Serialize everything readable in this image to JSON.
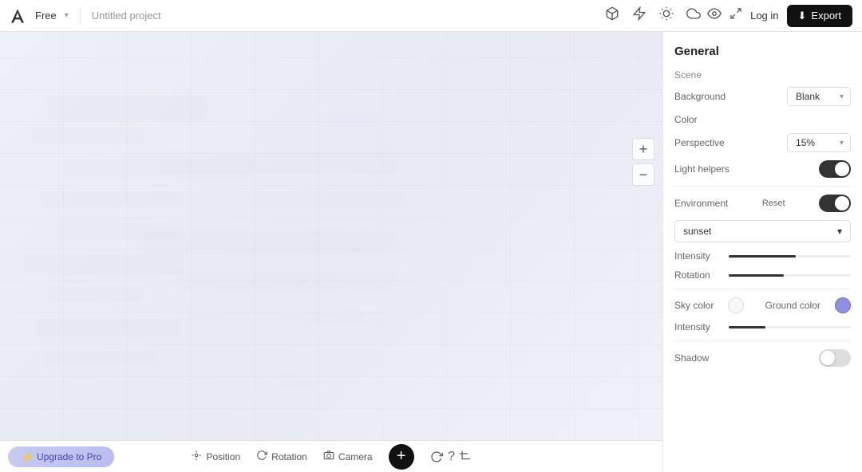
{
  "topbar": {
    "logo_alt": "Adobe logo",
    "plan_label": "Free",
    "plan_arrow": "▾",
    "project_name": "Untitled project",
    "icons": [
      {
        "name": "cube-icon",
        "symbol": "⬡"
      },
      {
        "name": "lightning-icon",
        "symbol": "⚡"
      },
      {
        "name": "sun-icon",
        "symbol": "☀"
      },
      {
        "name": "cloud-icon",
        "symbol": "☁"
      }
    ],
    "eye_icon": "👁",
    "expand_icon": "⤢",
    "login_label": "Log in",
    "export_icon": "⬇",
    "export_label": "Export"
  },
  "canvas": {
    "plus_label": "+",
    "minus_label": "−"
  },
  "bottom_toolbar": {
    "position_label": "Position",
    "rotation_label": "Rotation",
    "camera_label": "Camera",
    "add_icon": "+",
    "refresh_icon": "↻",
    "crop_icon": "⊡",
    "help_icon": "?"
  },
  "upgrade": {
    "icon": "⚡",
    "label": "Upgrade to Pro"
  },
  "panel": {
    "title": "General",
    "scene_label": "Scene",
    "background_label": "Background",
    "background_value": "Blank",
    "color_label": "Color",
    "perspective_label": "Perspective",
    "perspective_value": "15%",
    "light_helpers_label": "Light helpers",
    "environment_label": "Environment",
    "environment_reset": "Reset",
    "environment_dropdown": "sunset",
    "intensity_label": "Intensity",
    "rotation_label": "Rotation",
    "sky_color_label": "Sky color",
    "ground_color_label": "Ground color",
    "intensity2_label": "Intensity",
    "shadow_label": "Shadow"
  }
}
